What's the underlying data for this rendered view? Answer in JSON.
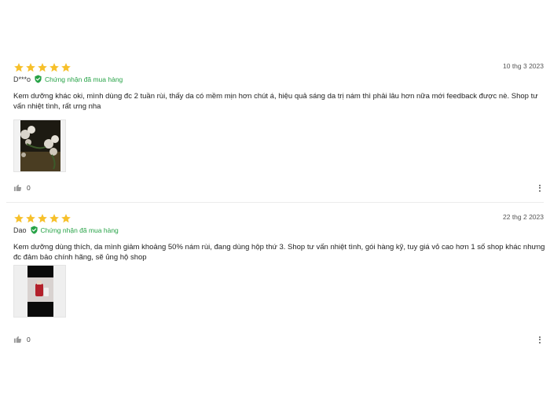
{
  "colors": {
    "star": "#f7c02b",
    "verified": "#27a347",
    "text": "#222222",
    "muted": "#555555"
  },
  "reviews": [
    {
      "rating": 5,
      "date": "10 thg 3 2023",
      "author": "D***o",
      "verified_label": "Chứng nhận đã mua hàng",
      "content": "Kem dưỡng khác oki, mình dùng đc 2 tuần rùi, thấy da có mềm mịn hơn chút á, hiệu quả sáng da trị nám thì phải lâu hơn nữa mới feedback được nè. Shop tư vấn nhiệt tình, rất ưng nha",
      "photo_icon": "review-photo-flowers",
      "like_icon": "thumbs-up-icon",
      "likes": "0",
      "menu_icon": "more-vertical-icon"
    },
    {
      "rating": 5,
      "date": "22 thg 2 2023",
      "author": "Dao",
      "verified_label": "Chứng nhận đã mua hàng",
      "content": "Kem dưỡng dùng thích, da mình giảm khoảng 50% nám rùi, đang dùng hộp thứ 3. Shop tư vấn nhiệt tình, gói hàng kỹ, tuy giá vỏ cao hơn 1 số shop khác nhưng đc đảm bảo chính hãng, sẽ ủng hộ shop",
      "photo_icon": "review-photo-product",
      "like_icon": "thumbs-up-icon",
      "likes": "0",
      "menu_icon": "more-vertical-icon"
    }
  ]
}
